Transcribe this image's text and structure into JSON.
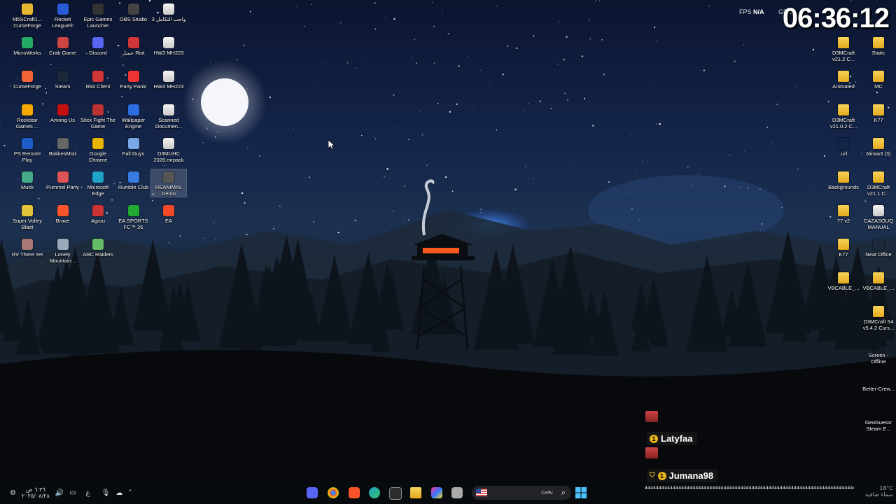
{
  "overlay": {
    "clock": "06:36:12",
    "fps_label": "FPS",
    "fps_value": "N/A",
    "gpu_label": "GPU"
  },
  "desktop_left": [
    {
      "label": "M5SCraft1... CurseForge",
      "icon": "curseforge-folder-icon",
      "color": "#e8b730"
    },
    {
      "label": "Rocket League®",
      "icon": "rocket-league-icon",
      "color": "#2a5bd7"
    },
    {
      "label": "Epic Games Launcher",
      "icon": "epic-games-icon",
      "color": "#333"
    },
    {
      "label": "OBS Studio",
      "icon": "obs-icon",
      "color": "#444"
    },
    {
      "label": "واجب التكامل 3",
      "icon": "document-icon",
      "color": "#ddd"
    },
    {
      "label": "MicroWorks",
      "icon": "microworks-icon",
      "color": "#2a6"
    },
    {
      "label": "Crab Game",
      "icon": "crab-game-icon",
      "color": "#c44"
    },
    {
      "label": "Discord",
      "icon": "discord-icon",
      "color": "#5865f2"
    },
    {
      "label": "عميل Riot",
      "icon": "riot-client-icon",
      "color": "#d13639"
    },
    {
      "label": "HW3 MH223",
      "icon": "document-icon",
      "color": "#ddd"
    },
    {
      "label": "CurseForge",
      "icon": "curseforge-icon",
      "color": "#f16436"
    },
    {
      "label": "Steam",
      "icon": "steam-icon",
      "color": "#1b2838"
    },
    {
      "label": "Riot Client",
      "icon": "riot-client-icon",
      "color": "#d13639"
    },
    {
      "label": "Party Panic",
      "icon": "party-panic-icon",
      "color": "#e33"
    },
    {
      "label": "HW4 MH223",
      "icon": "document-icon",
      "color": "#ddd"
    },
    {
      "label": "Rockstar Games ...",
      "icon": "rockstar-icon",
      "color": "#f5a800"
    },
    {
      "label": "Among Us",
      "icon": "among-us-icon",
      "color": "#c51111"
    },
    {
      "label": "Stick Fight The Game",
      "icon": "stick-fight-icon",
      "color": "#b33"
    },
    {
      "label": "Wallpaper Engine",
      "icon": "wallpaper-engine-icon",
      "color": "#2e6de0"
    },
    {
      "label": "Scanned Documen...",
      "icon": "document-icon",
      "color": "#ddd"
    },
    {
      "label": "PS Remote Play",
      "icon": "ps-remote-play-icon",
      "color": "#1f5ec8"
    },
    {
      "label": "BakkesMod",
      "icon": "bakkesmod-icon",
      "color": "#666"
    },
    {
      "label": "Google Chrome",
      "icon": "chrome-icon",
      "color": "#e9b500"
    },
    {
      "label": "Fall Guys",
      "icon": "fall-guys-icon",
      "color": "#7aa7e8"
    },
    {
      "label": "D3MUHC 2026.mrpack",
      "icon": "file-icon",
      "color": "#ddd"
    },
    {
      "label": "Muck",
      "icon": "muck-icon",
      "color": "#4a8"
    },
    {
      "label": "Pummel Party",
      "icon": "pummel-party-icon",
      "color": "#d55"
    },
    {
      "label": "Microsoft Edge",
      "icon": "edge-icon",
      "color": "#1fa3c9"
    },
    {
      "label": "Rumble Club",
      "icon": "rumble-club-icon",
      "color": "#3a7be0"
    },
    {
      "label": "REANIMAL Demo",
      "icon": "reanimal-icon",
      "color": "#555"
    },
    {
      "label": "Super Volley Blast",
      "icon": "super-volley-icon",
      "color": "#e3c43a"
    },
    {
      "label": "Brave",
      "icon": "brave-icon",
      "color": "#fb542b"
    },
    {
      "label": "Agrou",
      "icon": "agrou-icon",
      "color": "#c33"
    },
    {
      "label": "EA SPORTS FC™ 26",
      "icon": "ea-fc-icon",
      "color": "#2a3"
    },
    {
      "label": "EA",
      "icon": "ea-icon",
      "color": "#f34a2a"
    },
    {
      "label": "RV There Yet",
      "icon": "rv-there-yet-icon",
      "color": "#a77"
    },
    {
      "label": "Lonely Mountain...",
      "icon": "lonely-mountains-icon",
      "color": "#9ab"
    },
    {
      "label": "ARC Raiders",
      "icon": "arc-raiders-icon",
      "color": "#6b6"
    }
  ],
  "desktop_right": [
    {
      "label": "D3MCraft v21.2 C...",
      "icon": "folder-icon"
    },
    {
      "label": "Static",
      "icon": "folder-icon"
    },
    {
      "label": "Animated",
      "icon": "folder-icon"
    },
    {
      "label": "MC",
      "icon": "folder-icon"
    },
    {
      "label": "D3MCraft v21.0.2 C...",
      "icon": "folder-icon"
    },
    {
      "label": "K77",
      "icon": "folder-icon"
    },
    {
      "label": ".url",
      "icon": "url-icon"
    },
    {
      "label": "Ninaa3 (3)",
      "icon": "folder-icon"
    },
    {
      "label": "Backgrounds",
      "icon": "folder-icon"
    },
    {
      "label": "D3MCraft v21.1 C...",
      "icon": "folder-icon"
    },
    {
      "label": "77 v2",
      "icon": "folder-icon"
    },
    {
      "label": "CAZASOUQ MANUAL",
      "icon": "document-icon"
    },
    {
      "label": "K77",
      "icon": "folder-icon"
    },
    {
      "label": "Neat Office",
      "icon": "neat-office-icon"
    },
    {
      "label": "VBCABLE_...",
      "icon": "folder-icon"
    },
    {
      "label": "VBCABLE_...",
      "icon": "folder-icon"
    },
    {
      "label": "D3MCraft S4 v5.4.2 Curs...",
      "icon": "folder-icon"
    },
    {
      "label": "Screen - Offline",
      "icon": "screen-icon"
    },
    {
      "label": "Better-Crew...",
      "icon": "better-crew-icon"
    },
    {
      "label": "GeoGuessr Steam E...",
      "icon": "geoguessr-icon"
    }
  ],
  "chat": {
    "user1": "Latyfaa",
    "user2": "Jumana98",
    "badge": "1",
    "wave": "⁴⁴⁴⁴⁴⁴⁴⁴⁴⁴⁴⁴⁴⁴⁴⁴⁴⁴⁴⁴⁴⁴⁴⁴⁴⁴⁴⁴⁴⁴⁴⁴⁴⁴⁴⁴⁴⁴⁴⁴⁴⁴⁴⁴⁴⁴⁴⁴⁴⁴⁴⁴⁴⁴⁴⁴⁴⁴⁴⁴⁴⁴⁴⁴⁴⁴⁴⁴⁴⁴⁴⁴⁴⁴⁴⁴⁴⁴⁴⁴⁴⁴⁴⁴⁴⁴⁴⁴⁴⁴⁴⁴⁴⁴⁴⁴⁴⁴⁴⁴⁴⁴⁴⁴⁴⁴⁴⁴⁴⁴⁴⁴⁴⁴⁴⁴"
  },
  "taskbar": {
    "time": "٦:٣٦ ص",
    "date": "٢٠٢٥/٠٨/٢٨",
    "lang": "ع",
    "search_placeholder": "بحث",
    "weather_temp": "18°C",
    "weather_text": "سماء صافية"
  }
}
